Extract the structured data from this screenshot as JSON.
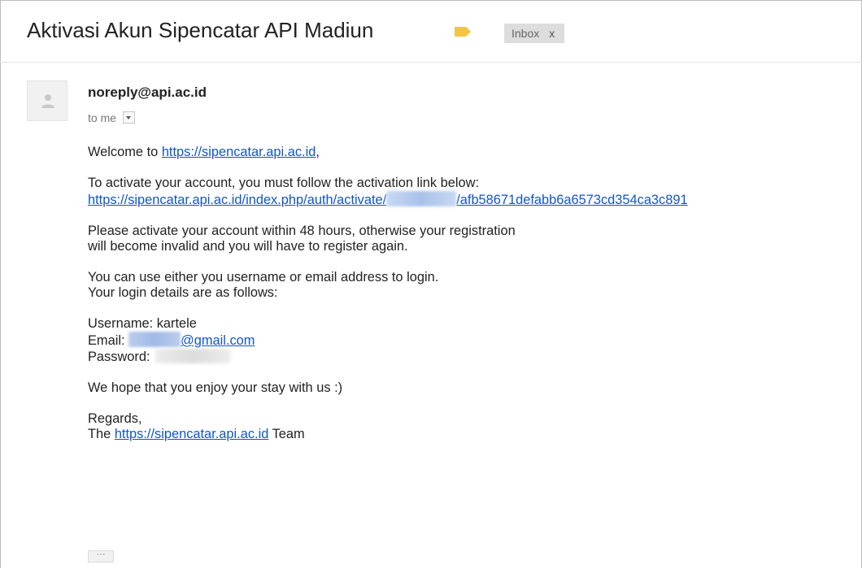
{
  "email": {
    "subject": "Aktivasi Akun Sipencatar API Madiun",
    "label_color": "#f4c542",
    "inbox_tag": {
      "label": "Inbox",
      "remove": "x"
    },
    "sender": "noreply@api.ac.id",
    "recipient": "to me",
    "body": {
      "welcome_prefix": "Welcome to",
      "welcome_link": "https://sipencatar.api.ac.id",
      "welcome_suffix": ",",
      "activate_line": "To activate your account, you must follow the activation link below:",
      "activation_link_prefix": "https://sipencatar.api.ac.id/index.php/auth/activate/",
      "activation_link_suffix": "/afb58671defabb6a6573cd354ca3c891",
      "validity_line1": "Please activate your account within 48 hours, otherwise your registration",
      "validity_line2": "will become invalid and you will have to register again.",
      "login_line1": "You can use either you username or email address to login.",
      "login_line2": "Your login details are as follows:",
      "username_line": "Username: kartele",
      "email_label": "Email:",
      "email_domain": "@gmail.com",
      "password_label": "Password:",
      "enjoy_line": "We hope that you enjoy your stay with us :)",
      "regards": "Regards,",
      "team_prefix": "The",
      "team_link": "https://sipencatar.api.ac.id",
      "team_suffix": "Team"
    },
    "more_button": "···"
  }
}
